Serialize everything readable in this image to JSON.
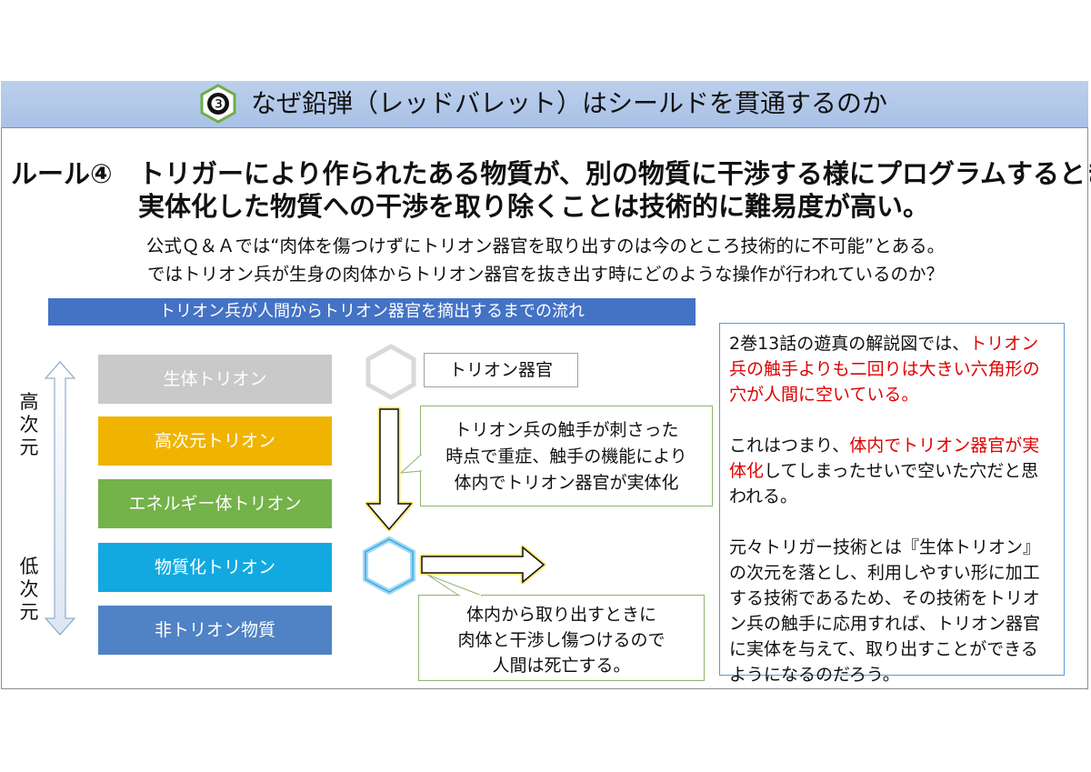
{
  "header": {
    "badge_number": "❸",
    "title": "なぜ鉛弾（レッドバレット）はシールドを貫通するのか"
  },
  "rule": {
    "label": "ルール④",
    "line1": "トリガーにより作られたある物質が、別の物質に干渉する様にプログラムするとき、",
    "line2": "実体化した物質への干渉を取り除くことは技術的に難易度が高い。"
  },
  "intro": {
    "line1": "公式Ｑ＆Ａでは“肉体を傷つけずにトリオン器官を取り出すのは今のところ技術的に不可能”とある。",
    "line2": "ではトリオン兵が生身の肉体からトリオン器官を抜き出す時にどのような操作が行われているのか？"
  },
  "flow": {
    "title": "トリオン兵が人間からトリオン器官を摘出するまでの流れ",
    "axis_high": [
      "高",
      "次",
      "元"
    ],
    "axis_low": [
      "低",
      "次",
      "元"
    ],
    "layers": [
      {
        "label": "生体トリオン",
        "color": "#c9c9c9"
      },
      {
        "label": "高次元トリオン",
        "color": "#f0b400"
      },
      {
        "label": "エネルギー体トリオン",
        "color": "#74b24a"
      },
      {
        "label": "物質化トリオン",
        "color": "#12a9e0"
      },
      {
        "label": "非トリオン物質",
        "color": "#4f83c5"
      }
    ],
    "organ_label": "トリオン器官",
    "callout_top": [
      "トリオン兵の触手が刺さった",
      "時点で重症、触手の機能により",
      "体内でトリオン器官が実体化"
    ],
    "callout_bottom": [
      "体内から取り出すときに",
      "肉体と干渉し傷つけるので",
      "人間は死亡する。"
    ]
  },
  "note": {
    "p1": [
      {
        "text": "2巻13話の遊真の解説図では、",
        "red": false
      },
      {
        "text": "トリオン兵の触手よりも二回りは大きい六角形の穴が人間に空いている。",
        "red": true
      }
    ],
    "p2": [
      {
        "text": "これはつまり、",
        "red": false
      },
      {
        "text": "体内でトリオン器官が実体化",
        "red": true
      },
      {
        "text": "してしまったせいで空いた穴だと思われる。",
        "red": false
      }
    ],
    "p3": [
      {
        "text": "元々トリガー技術とは『生体トリオン』の次元を落とし、利用しやすい形に加工する技術であるため、その技術をトリオン兵の触手に応用すれば、トリオン器官に実体を与えて、取り出すことができるようになるのだろう。",
        "red": false
      }
    ]
  }
}
